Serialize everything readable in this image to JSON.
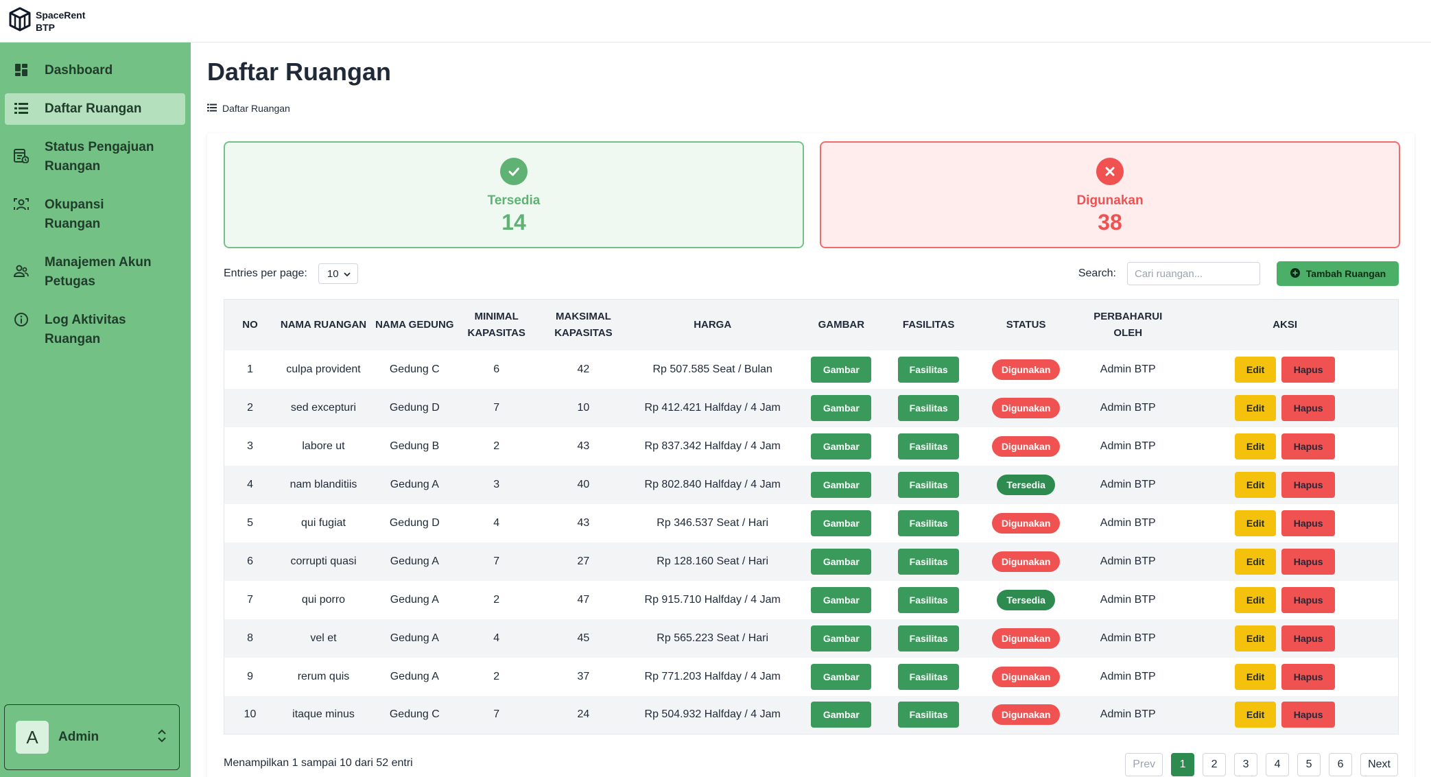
{
  "brand": {
    "line1": "SpaceRent",
    "line2": "BTP"
  },
  "sidebar": {
    "items": [
      {
        "label": "Dashboard",
        "icon": "dashboard-icon"
      },
      {
        "label": "Daftar Ruangan",
        "icon": "list-icon",
        "active": true
      },
      {
        "label": "Status Pengajuan Ruangan",
        "icon": "request-status-icon"
      },
      {
        "label": "Okupansi Ruangan",
        "icon": "occupancy-icon"
      },
      {
        "label": "Manajemen Akun Petugas",
        "icon": "users-icon"
      },
      {
        "label": "Log Aktivitas Ruangan",
        "icon": "info-icon"
      }
    ],
    "user": {
      "initial": "A",
      "name": "Admin"
    }
  },
  "page": {
    "title": "Daftar Ruangan",
    "breadcrumb": "Daftar Ruangan"
  },
  "stats": {
    "available": {
      "label": "Tersedia",
      "value": "14"
    },
    "used": {
      "label": "Digunakan",
      "value": "38"
    }
  },
  "controls": {
    "entries_label": "Entries per page:",
    "entries_value": "10",
    "search_label": "Search:",
    "search_placeholder": "Cari ruangan...",
    "add_button": "Tambah Ruangan"
  },
  "table": {
    "headers": [
      "NO",
      "NAMA RUANGAN",
      "NAMA GEDUNG",
      "MINIMAL KAPASITAS",
      "MAKSIMAL KAPASITAS",
      "HARGA",
      "GAMBAR",
      "FASILITAS",
      "STATUS",
      "PERBAHARUI OLEH",
      "AKSI"
    ],
    "labels": {
      "gambar": "Gambar",
      "fasilitas": "Fasilitas",
      "edit": "Edit",
      "hapus": "Hapus"
    },
    "rows": [
      {
        "no": "1",
        "nama": "culpa provident",
        "gedung": "Gedung C",
        "min": "6",
        "max": "42",
        "harga": "Rp 507.585 Seat / Bulan",
        "status": "Digunakan",
        "oleh": "Admin BTP"
      },
      {
        "no": "2",
        "nama": "sed excepturi",
        "gedung": "Gedung D",
        "min": "7",
        "max": "10",
        "harga": "Rp 412.421 Halfday / 4 Jam",
        "status": "Digunakan",
        "oleh": "Admin BTP"
      },
      {
        "no": "3",
        "nama": "labore ut",
        "gedung": "Gedung B",
        "min": "2",
        "max": "43",
        "harga": "Rp 837.342 Halfday / 4 Jam",
        "status": "Digunakan",
        "oleh": "Admin BTP"
      },
      {
        "no": "4",
        "nama": "nam blanditiis",
        "gedung": "Gedung A",
        "min": "3",
        "max": "40",
        "harga": "Rp 802.840 Halfday / 4 Jam",
        "status": "Tersedia",
        "oleh": "Admin BTP"
      },
      {
        "no": "5",
        "nama": "qui fugiat",
        "gedung": "Gedung D",
        "min": "4",
        "max": "43",
        "harga": "Rp 346.537 Seat / Hari",
        "status": "Digunakan",
        "oleh": "Admin BTP"
      },
      {
        "no": "6",
        "nama": "corrupti quasi",
        "gedung": "Gedung A",
        "min": "7",
        "max": "27",
        "harga": "Rp 128.160 Seat / Hari",
        "status": "Digunakan",
        "oleh": "Admin BTP"
      },
      {
        "no": "7",
        "nama": "qui porro",
        "gedung": "Gedung A",
        "min": "2",
        "max": "47",
        "harga": "Rp 915.710 Halfday / 4 Jam",
        "status": "Tersedia",
        "oleh": "Admin BTP"
      },
      {
        "no": "8",
        "nama": "vel et",
        "gedung": "Gedung A",
        "min": "4",
        "max": "45",
        "harga": "Rp 565.223 Seat / Hari",
        "status": "Digunakan",
        "oleh": "Admin BTP"
      },
      {
        "no": "9",
        "nama": "rerum quis",
        "gedung": "Gedung A",
        "min": "2",
        "max": "37",
        "harga": "Rp 771.203 Halfday / 4 Jam",
        "status": "Digunakan",
        "oleh": "Admin BTP"
      },
      {
        "no": "10",
        "nama": "itaque minus",
        "gedung": "Gedung C",
        "min": "7",
        "max": "24",
        "harga": "Rp 504.932 Halfday / 4 Jam",
        "status": "Digunakan",
        "oleh": "Admin BTP"
      }
    ]
  },
  "footer": {
    "info": "Menampilkan 1 sampai 10 dari 52 entri",
    "prev": "Prev",
    "next": "Next",
    "pages": [
      "1",
      "2",
      "3",
      "4",
      "5",
      "6"
    ],
    "current_page": "1"
  },
  "colors": {
    "sidebar": "#73c184",
    "primary_green": "#2e8b50",
    "danger": "#f05252",
    "warning": "#f4c20d"
  }
}
